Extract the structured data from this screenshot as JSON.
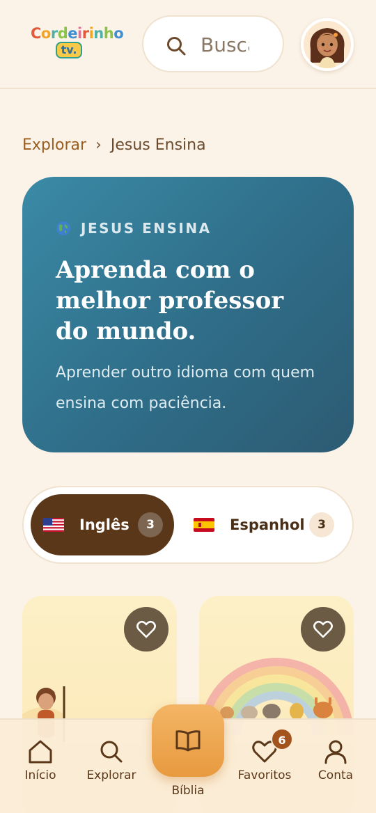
{
  "header": {
    "logo_text": "Cordeirinho",
    "logo_sub": "tv.",
    "search_placeholder": "Buscar"
  },
  "breadcrumb": {
    "parent": "Explorar",
    "separator": "›",
    "current": "Jesus Ensina"
  },
  "hero": {
    "eyebrow": "JESUS ENSINA",
    "title": "Aprenda com o melhor professor do mundo.",
    "subtitle": "Aprender outro idioma com quem ensina com paciência."
  },
  "languages": [
    {
      "label": "Inglês",
      "count": "3",
      "selected": true
    },
    {
      "label": "Espanhol",
      "count": "3",
      "selected": false
    }
  ],
  "bottom_nav": {
    "home": "Início",
    "explore": "Explorar",
    "bible": "Bíblia",
    "favorites": "Favoritos",
    "favorites_badge": "6",
    "account": "Conta"
  },
  "colors": {
    "background": "#fbf3e7",
    "hero": "#2f6d88",
    "accent_dark": "#5a3719",
    "accent_orange": "#e89a3f"
  }
}
